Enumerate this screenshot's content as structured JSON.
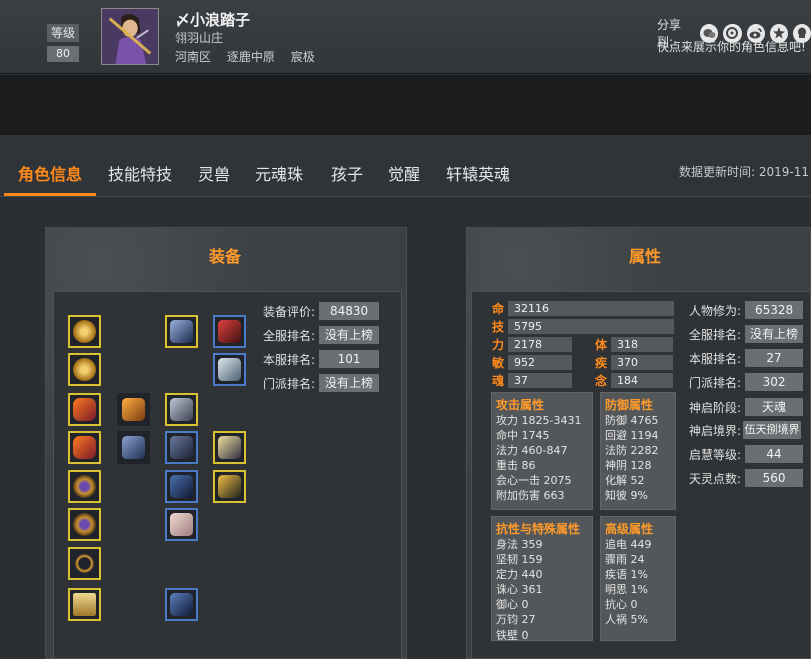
{
  "profile": {
    "level_label": "等级",
    "level_value": "80",
    "name": "〆小浪踏子",
    "guild": "翎羽山庄",
    "region": "河南区",
    "server": "逐鹿中原",
    "school": "宸极",
    "share_label": "分享到:",
    "share_hint": "快点来展示你的角色信息吧!",
    "share_icons": [
      "wechat-icon",
      "qzone-icon",
      "weibo-icon",
      "moments-icon",
      "qq-icon"
    ]
  },
  "tabs": [
    {
      "label": "角色信息",
      "active": true
    },
    {
      "label": "技能特技"
    },
    {
      "label": "灵兽"
    },
    {
      "label": "元魂珠"
    },
    {
      "label": "孩子"
    },
    {
      "label": "觉醒"
    },
    {
      "label": "轩辕英魂"
    }
  ],
  "update_time": "数据更新时间:  2019-11",
  "equipment": {
    "title": "装备",
    "score_label": "装备评价:",
    "score_value": "84830",
    "all_rank_label": "全服排名:",
    "all_rank_value": "没有上榜",
    "server_rank_label": "本服排名:",
    "server_rank_value": "101",
    "school_rank_label": "门派排名:",
    "school_rank_value": "没有上榜"
  },
  "attributes": {
    "title": "属性",
    "ming_label": "命",
    "ming_value": "32116",
    "ji_label": "技",
    "ji_value": "5795",
    "li_label": "力",
    "li_value": "2178",
    "ti_label": "体",
    "ti_value": "318",
    "min_label": "敏",
    "min_value": "952",
    "ji2_label": "疾",
    "ji2_value": "370",
    "hun_label": "魂",
    "hun_value": "37",
    "nian_label": "念",
    "nian_value": "184",
    "attack": {
      "title": "攻击属性",
      "rows": [
        [
          "攻力",
          "1825-3431"
        ],
        [
          "命中",
          "1745"
        ],
        [
          "法力",
          "460-847"
        ],
        [
          "重击",
          "86"
        ],
        [
          "会心一击",
          "2075"
        ],
        [
          "附加伤害",
          "663"
        ]
      ]
    },
    "defense": {
      "title": "防御属性",
      "rows": [
        [
          "防御",
          "4765"
        ],
        [
          "回避",
          "1194"
        ],
        [
          "法防",
          "2282"
        ],
        [
          "神阴",
          "128"
        ],
        [
          "化解",
          "52"
        ],
        [
          "知彼",
          "9%"
        ]
      ]
    },
    "resist": {
      "title": "抗性与特殊属性",
      "rows": [
        [
          "身法",
          "359"
        ],
        [
          "坚韧",
          "159"
        ],
        [
          "定力",
          "440"
        ],
        [
          "诛心",
          "361"
        ],
        [
          "御心",
          "0"
        ],
        [
          "万钧",
          "27"
        ],
        [
          "铁壁",
          "0"
        ]
      ]
    },
    "advanced": {
      "title": "高级属性",
      "rows": [
        [
          "追电",
          "449"
        ],
        [
          "骤雨",
          "24"
        ],
        [
          "疾语",
          "1%"
        ],
        [
          "明思",
          "1%"
        ],
        [
          "抗心",
          "0"
        ],
        [
          "人祸",
          "5%"
        ]
      ]
    },
    "cultivation_label": "人物修为:",
    "cultivation_value": "65328",
    "all_rank_label": "全服排名:",
    "all_rank_value": "没有上榜",
    "server_rank_label": "本服排名:",
    "server_rank_value": "27",
    "school_rank_label": "门派排名:",
    "school_rank_value": "302",
    "shenqi_stage_label": "神启阶段:",
    "shenqi_stage_value": "天魂",
    "shenqi_realm_label": "神启境界:",
    "shenqi_realm_value": "伍天捌境界",
    "qihui_label": "启慧等级:",
    "qihui_value": "44",
    "tianling_label": "天灵点数:",
    "tianling_value": "560"
  }
}
